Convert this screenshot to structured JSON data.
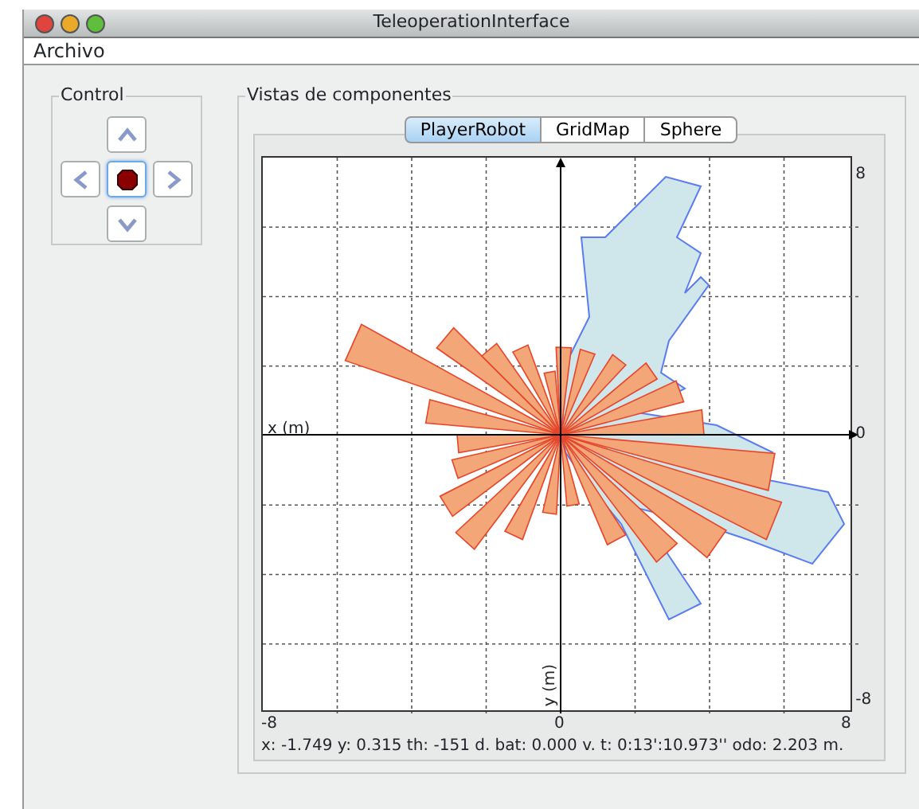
{
  "window": {
    "title": "TeleoperationInterface"
  },
  "menu": [
    "Archivo"
  ],
  "control": {
    "title": "Control",
    "buttons": [
      {
        "kind": "up"
      },
      {
        "kind": "left"
      },
      {
        "kind": "stop"
      },
      {
        "kind": "right"
      },
      {
        "kind": "down"
      }
    ]
  },
  "views": {
    "title": "Vistas de componentes",
    "tabs": [
      {
        "label": "PlayerRobot",
        "selected": true
      },
      {
        "label": "GridMap",
        "selected": false
      },
      {
        "label": "Sphere",
        "selected": false
      }
    ],
    "plot": {
      "x_axis_label": "x (m)",
      "y_axis_label": "y (m)",
      "right_ticks": [
        "8",
        "0",
        "-8"
      ],
      "bottom_ticks": [
        "-8",
        "0",
        "8"
      ]
    },
    "status": "x: -1.749 y: 0.315 th: -151 d. bat: 0.000 v. t: 0:13':10.973'' odo: 2.203 m."
  }
}
